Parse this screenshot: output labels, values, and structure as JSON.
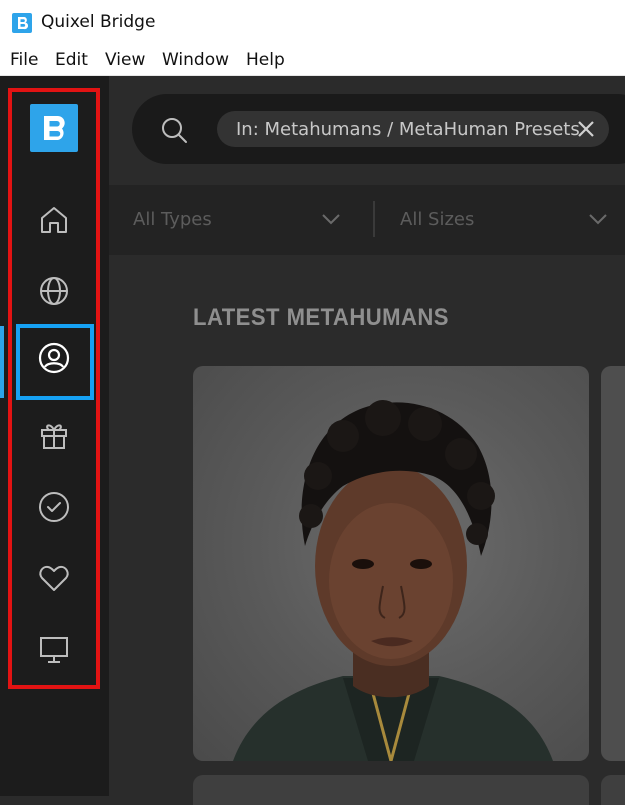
{
  "window": {
    "title": "Quixel Bridge"
  },
  "menu": {
    "items": [
      "File",
      "Edit",
      "View",
      "Window",
      "Help"
    ]
  },
  "sidebar": {
    "logo_letter": "B",
    "items": [
      {
        "name": "home",
        "icon": "home-icon"
      },
      {
        "name": "browse",
        "icon": "globe-icon"
      },
      {
        "name": "metahumans",
        "icon": "user-circle-icon",
        "active": true
      },
      {
        "name": "free",
        "icon": "gift-icon"
      },
      {
        "name": "purchased",
        "icon": "check-circle-icon"
      },
      {
        "name": "favorites",
        "icon": "heart-icon"
      },
      {
        "name": "local",
        "icon": "monitor-icon"
      }
    ]
  },
  "search": {
    "filter_chip": "In: Metahumans / MetaHuman Presets"
  },
  "filters": {
    "type": "All Types",
    "size": "All Sizes"
  },
  "content": {
    "section_title": "LATEST METAHUMANS"
  },
  "colors": {
    "accent": "#2ea4ea",
    "highlight_red": "#e21313",
    "highlight_blue": "#16a1f3",
    "sidebar_bg": "#1c1c1c",
    "main_bg": "#2b2b2b"
  }
}
